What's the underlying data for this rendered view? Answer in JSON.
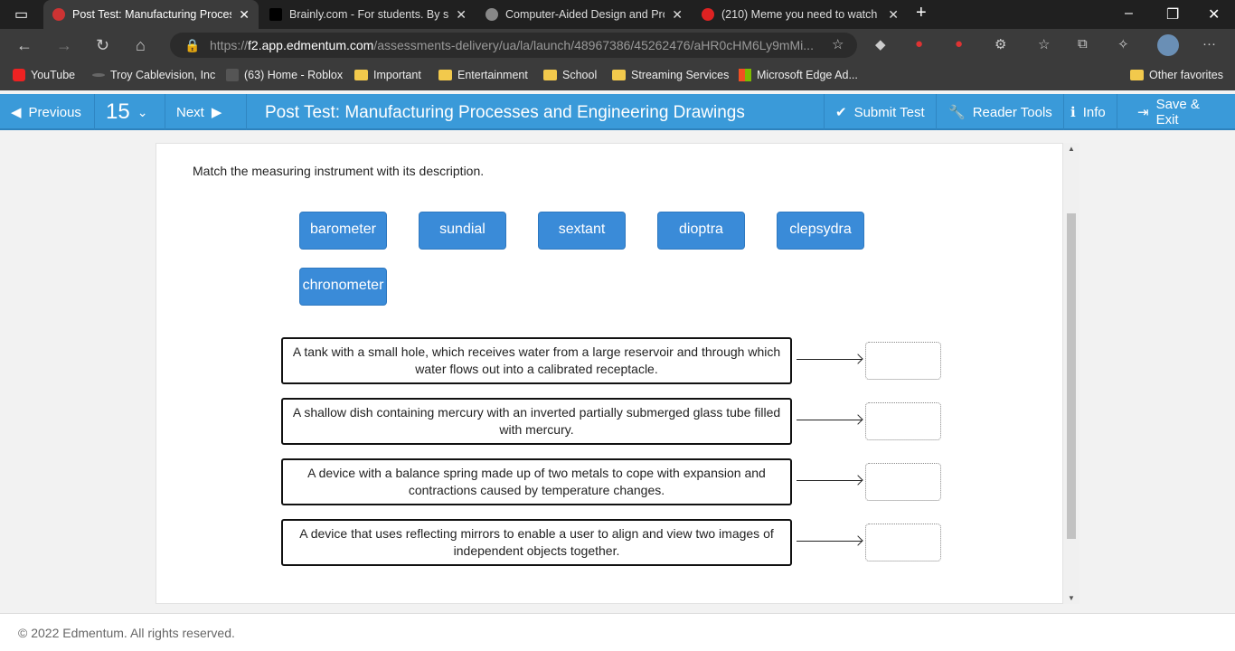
{
  "browser": {
    "tabs": [
      {
        "title": "Post Test: Manufacturing Processes and Engineering Drawings",
        "active": true
      },
      {
        "title": "Brainly.com - For students. By students."
      },
      {
        "title": "Computer-Aided Design and Production"
      },
      {
        "title": "(210) Meme you need to watch"
      }
    ],
    "url_prefix": "https://",
    "url_host": "f2.app.edmentum.com",
    "url_path": "/assessments-delivery/ua/la/launch/48967386/45262476/aHR0cHM6Ly9mMi...",
    "bookmarks": [
      "YouTube",
      "Troy Cablevision, Inc",
      "(63) Home - Roblox",
      "Important",
      "Entertainment",
      "School",
      "Streaming Services",
      "Microsoft Edge Ad..."
    ],
    "other_favorites": "Other favorites"
  },
  "toolbar": {
    "previous": "Previous",
    "question_number": "15",
    "next": "Next",
    "title": "Post Test: Manufacturing Processes and Engineering Drawings",
    "submit": "Submit Test",
    "reader_tools": "Reader Tools",
    "info": "Info",
    "save_exit": "Save & Exit",
    "color": "#3a9ad9"
  },
  "question": {
    "prompt": "Match the measuring instrument with its description.",
    "options": [
      "barometer",
      "sundial",
      "sextant",
      "dioptra",
      "clepsydra",
      "chronometer"
    ],
    "descriptions": [
      "A tank with a small hole, which receives water from a large reservoir and through which water flows out into a calibrated receptacle.",
      "A shallow dish containing mercury with an inverted partially submerged glass tube filled with mercury.",
      "A device with a balance spring made up of two metals to cope with expansion and contractions caused by temperature changes.",
      "A device that uses reflecting mirrors to enable a user to align and view two images of independent objects together."
    ]
  },
  "footer": "© 2022 Edmentum. All rights reserved."
}
